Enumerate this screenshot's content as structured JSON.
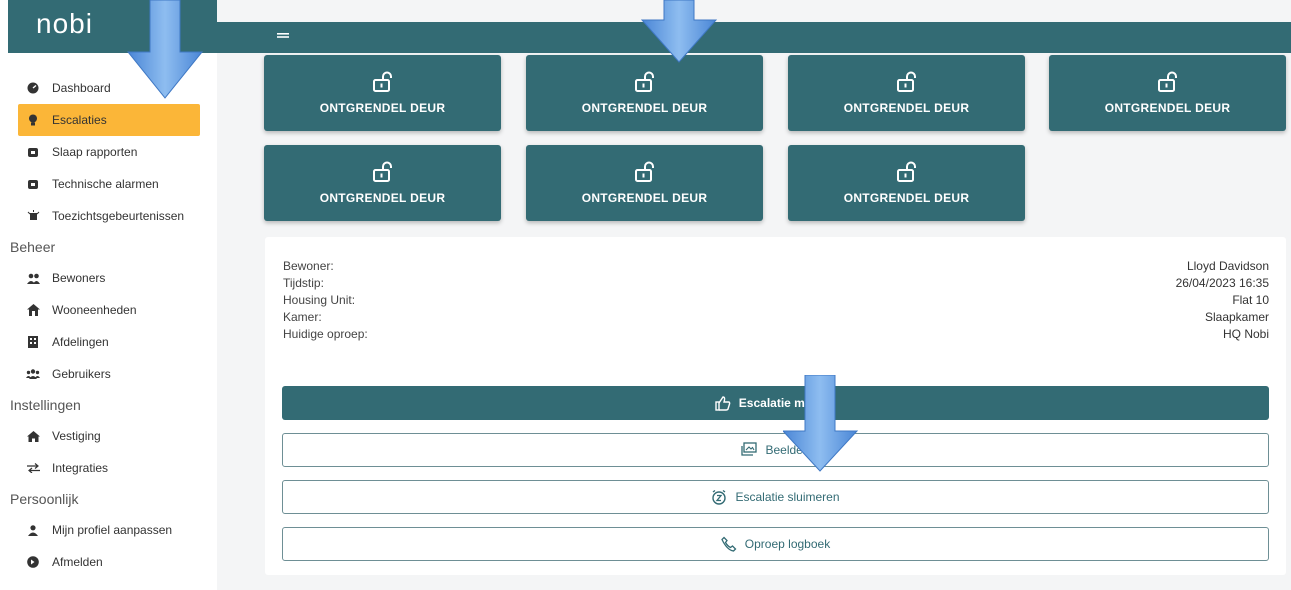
{
  "app": {
    "logo": "nobi",
    "menu_icon": "hamburger-icon"
  },
  "sidebar": {
    "items": [
      {
        "label": "Dashboard",
        "icon": "dashboard-icon",
        "active": false
      },
      {
        "label": "Escalaties",
        "icon": "bulb-icon",
        "active": true
      },
      {
        "label": "Slaap rapporten",
        "icon": "alarm-clock-icon",
        "active": false
      },
      {
        "label": "Technische alarmen",
        "icon": "alarm-clock-icon",
        "active": false
      },
      {
        "label": "Toezichtsgebeurtenissen",
        "icon": "surveillance-icon",
        "active": false
      }
    ],
    "beheer_title": "Beheer",
    "beheer": [
      {
        "label": "Bewoners",
        "icon": "users-icon"
      },
      {
        "label": "Wooneenheden",
        "icon": "home-icon"
      },
      {
        "label": "Afdelingen",
        "icon": "building-icon"
      },
      {
        "label": "Gebruikers",
        "icon": "user-group-icon"
      }
    ],
    "instellingen_title": "Instellingen",
    "instellingen": [
      {
        "label": "Vestiging",
        "icon": "house-icon"
      },
      {
        "label": "Integraties",
        "icon": "exchange-icon"
      }
    ],
    "persoonlijk_title": "Persoonlijk",
    "persoonlijk": [
      {
        "label": "Mijn profiel aanpassen",
        "icon": "user-icon"
      },
      {
        "label": "Afmelden",
        "icon": "logout-icon"
      }
    ]
  },
  "doors": [
    {
      "label": "ONTGRENDEL DEUR"
    },
    {
      "label": "ONTGRENDEL DEUR"
    },
    {
      "label": "ONTGRENDEL DEUR"
    },
    {
      "label": "ONTGRENDEL DEUR"
    },
    {
      "label": "ONTGRENDEL DEUR"
    },
    {
      "label": "ONTGRENDEL DEUR"
    },
    {
      "label": "ONTGRENDEL DEUR"
    }
  ],
  "escalation": {
    "rows": [
      {
        "label": "Bewoner:",
        "value": "Lloyd Davidson"
      },
      {
        "label": "Tijdstip:",
        "value": "26/04/2023 16:35"
      },
      {
        "label": "Housing Unit:",
        "value": "Flat 10"
      },
      {
        "label": "Kamer:",
        "value": "Slaapkamer"
      },
      {
        "label": "Huidige oproep:",
        "value": "HQ Nobi"
      }
    ],
    "actions": {
      "resolve": "Escalatie melden",
      "images": "Beelden",
      "snooze": "Escalatie sluimeren",
      "call_log": "Oproep logboek"
    }
  },
  "colors": {
    "primary": "#336b74",
    "active": "#fbb638",
    "arrow": "#5b9be0"
  }
}
